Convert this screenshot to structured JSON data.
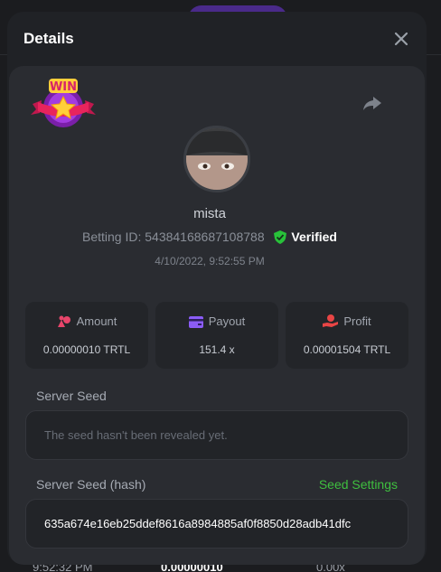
{
  "modal": {
    "title": "Details",
    "close_icon": "close-icon",
    "share_icon": "share-icon",
    "badge_text": "WIN"
  },
  "player": {
    "username": "mista",
    "betting_id_label": "Betting ID:",
    "betting_id": "54384168687108788",
    "verified_label": "Verified",
    "timestamp": "4/10/2022, 9:52:55 PM"
  },
  "stats": [
    {
      "label": "Amount",
      "value": "0.00000010 TRTL",
      "icon": "coins-icon",
      "color": "#e8456b"
    },
    {
      "label": "Payout",
      "value": "151.4 x",
      "icon": "wallet-icon",
      "color": "#8b5cf6"
    },
    {
      "label": "Profit",
      "value": "0.00001504 TRTL",
      "icon": "hand-coin-icon",
      "color": "#e84545"
    }
  ],
  "server_seed": {
    "label": "Server Seed",
    "placeholder": "The seed hasn't been revealed yet."
  },
  "server_seed_hash": {
    "label": "Server Seed (hash)",
    "settings_link": "Seed Settings",
    "value": "635a674e16eb25ddef8616a8984885af0f8850d28adb41dfc"
  },
  "background": {
    "time": "9:52:32 PM",
    "amount": "0.00000010",
    "payout": "0.00x"
  },
  "colors": {
    "accent_green": "#3fbf3f",
    "modal_bg": "#202226",
    "panel_bg": "#2a2c31"
  }
}
